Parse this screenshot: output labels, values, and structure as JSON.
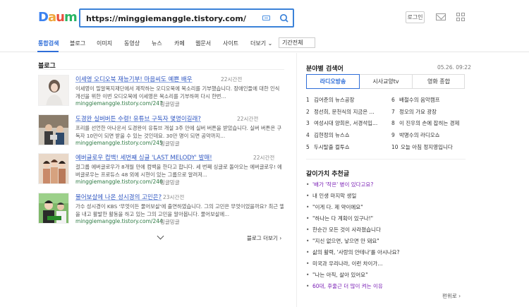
{
  "logo": {
    "text": "Daum"
  },
  "search": {
    "value": "https://minggiemanggle.tistory.com/"
  },
  "header": {
    "login_label": "로그인"
  },
  "nav": {
    "items": [
      "통합검색",
      "블로그",
      "이미지",
      "동영상",
      "뉴스",
      "카페",
      "웹문서",
      "사이트",
      "더보기"
    ],
    "period_label": "기간전체"
  },
  "blog": {
    "section_title": "블로그",
    "results": [
      {
        "title": "이세영 오디오북 재능기부! 마음씨도 예쁜 배우",
        "time": "22시간전",
        "snippet": [
          "이세영이 밀알복지재단에서 제작하는 오디오북에 목소리를 기부했습니다. 장애인들에 대한 인식",
          "개선을 위한 이번 오디오북에 이세영은 목소리를 기부하며 다시 한번..."
        ],
        "url": "minggiemanggle.tistory.com/247",
        "author": "밍글밍글"
      },
      {
        "title": "도경완 실버버튼 수령! 유튜브 구독자 몇명이길래?",
        "time": "22시간전",
        "snippet": [
          "프리를 선언한 아나운서 도경완이 유튜브 개설 3주 만에 실버 버튼을 받았습니다. 실버 버튼은 구",
          "독자 10만이 되면 받을 수 있는 것인데요. 30만 명이 되면 공약까지..."
        ],
        "url": "minggiemanggle.tistory.com/245",
        "author": "밍글밍글"
      },
      {
        "title": "에버글로우 컴백! 세번째 싱글 'LAST MELODY' 발매!",
        "time": "22시간전",
        "snippet": [
          "걸그룹 에버글로우가 8개월 만에 컴백을 한다고 합니다. 세 번째 싱글로 돌아오는 에버글로우! 에",
          "버글로우는 프로듀스 48 외에 시현이 있는 그룹으로 알려져..."
        ],
        "url": "minggiemanggle.tistory.com/246",
        "author": "밍글밍글"
      },
      {
        "title": "물어보살에 나온 성시경의 고민은?",
        "time": "23시간전",
        "snippet": [
          "가수 성시경이 KBS '무엇이든 물어보살'에 출연하였습니다. 그의 고민은 무엇이었을까요? 최근 앨범",
          "을 내고 활발한 활동을 하고 있는 그의 고민을 알아봅니다. 물어보살에..."
        ],
        "url": "minggiemanggle.tistory.com/244",
        "author": "밍글밍글"
      }
    ],
    "more_label": "블로그 더보기"
  },
  "realtime": {
    "title": "분야별 검색어",
    "time": "05.26. 09:22",
    "tabs": [
      "라디오방송",
      "시사교양tv",
      "영화 종합"
    ],
    "ranks_left": [
      {
        "n": "1",
        "t": "김어준의 뉴스공장"
      },
      {
        "n": "2",
        "t": "정선희, 문천식의 지금은 ..."
      },
      {
        "n": "3",
        "t": "여성시대 양희은, 서경석입..."
      },
      {
        "n": "4",
        "t": "김현정의 뉴스쇼"
      },
      {
        "n": "5",
        "t": "두시탈출 컬투쇼"
      }
    ],
    "ranks_right": [
      {
        "n": "6",
        "t": "배철수의 음악캠프"
      },
      {
        "n": "7",
        "t": "정오의 가요 광장"
      },
      {
        "n": "8",
        "t": "이 진우의 손에 잡히는 경제"
      },
      {
        "n": "9",
        "t": "박명수의 라디오쇼"
      },
      {
        "n": "10",
        "t": "오늘 아침 정지영입니다"
      }
    ]
  },
  "recommend": {
    "title": "같이가치 추천글",
    "items": [
      {
        "t": "'배가 '작은' 병이 있다고요?",
        "purple": true
      },
      {
        "t": "내 인생 마지막 생일",
        "purple": false
      },
      {
        "t": "\"이게 다. 제 약이에요\"",
        "purple": false
      },
      {
        "t": "\"하나는 다 계획이 있구나!\"",
        "purple": false
      },
      {
        "t": "한순간 모든 것이 사라졌습니다",
        "purple": false
      },
      {
        "t": "\"지신 없으면, 낳으면 안 돼요\"",
        "purple": false
      },
      {
        "t": "삶의 활력, '사랑의 안테나'를 아시나요?",
        "purple": false
      },
      {
        "t": "미국과 우리나라, 이런 차이가...",
        "purple": false
      },
      {
        "t": "\"나는 아직, 살아 있어요\"",
        "purple": false
      },
      {
        "t": "60대, 후줄근 더 많이 켜는 이유",
        "purple": true
      }
    ],
    "more_label": "펀위로"
  },
  "colors": {
    "accent": "#2f6ed8",
    "link": "#3057c2",
    "url": "#2d7a43",
    "visited": "#7a1fb5"
  }
}
